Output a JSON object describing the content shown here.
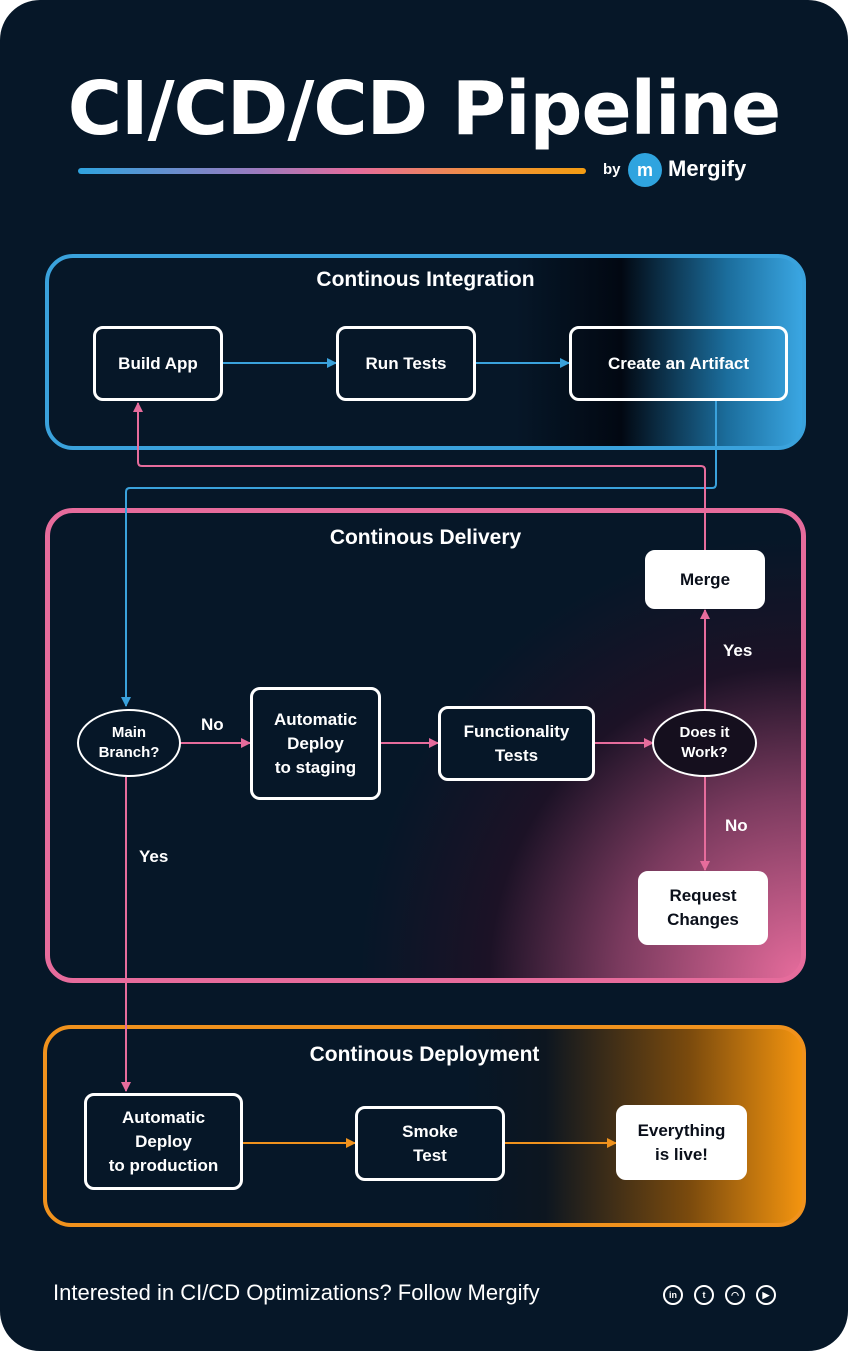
{
  "header": {
    "title": "CI/CD/CD Pipeline",
    "by_label": "by",
    "logo_glyph": "m",
    "brand_name": "Mergify"
  },
  "colors": {
    "background": "#061728",
    "ci": "#3aa2dc",
    "delivery": "#e66c9c",
    "deployment": "#f0921d"
  },
  "sections": {
    "ci": {
      "title": "Continous Integration",
      "nodes": [
        "Build App",
        "Run Tests",
        "Create an Artifact"
      ]
    },
    "delivery": {
      "title": "Continous Delivery",
      "main_branch": [
        "Main",
        "Branch?"
      ],
      "staging": [
        "Automatic",
        "Deploy",
        "to staging"
      ],
      "func_tests": [
        "Functionality",
        "Tests"
      ],
      "does_it_work": [
        "Does it",
        "Work?"
      ],
      "merge": "Merge",
      "request_changes": [
        "Request",
        "Changes"
      ],
      "label_no_main": "No",
      "label_yes_main": "Yes",
      "label_yes_work": "Yes",
      "label_no_work": "No"
    },
    "deployment": {
      "title": "Continous Deployment",
      "production": [
        "Automatic",
        "Deploy",
        "to production"
      ],
      "smoke": [
        "Smoke",
        "Test"
      ],
      "live": [
        "Everything",
        "is live!"
      ]
    }
  },
  "footer": {
    "text": "Interested in CI/CD Optimizations? Follow Mergify",
    "social": [
      {
        "name": "linkedin",
        "glyph": "in"
      },
      {
        "name": "twitter",
        "glyph": "t"
      },
      {
        "name": "github",
        "glyph": "◠"
      },
      {
        "name": "youtube",
        "glyph": "▶"
      }
    ]
  }
}
